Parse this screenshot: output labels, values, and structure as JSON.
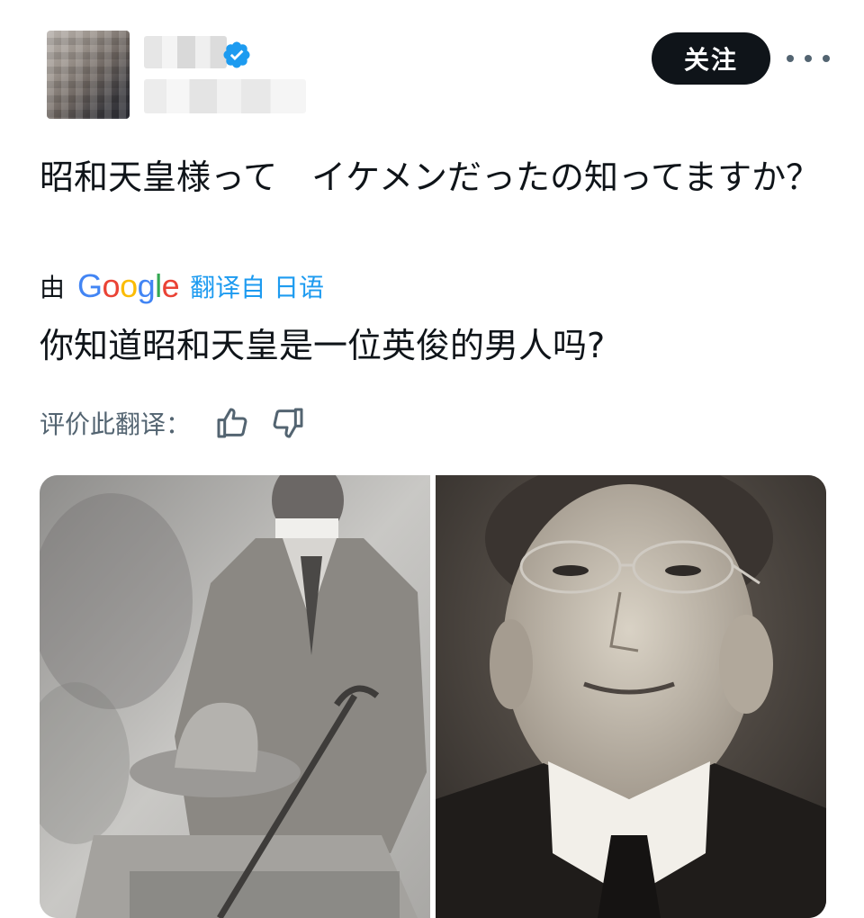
{
  "header": {
    "follow_label": "关注",
    "icons": [
      "verified-badge-icon",
      "more-options-icon"
    ]
  },
  "post": {
    "text": "昭和天皇様って　イケメンだったの知ってますか？",
    "translation_prefix": "由",
    "translation_provider": "Google",
    "translation_suffix": "翻译自 日语",
    "translated_text": "你知道昭和天皇是一位英俊的男人吗?",
    "rate_label": "评价此翻译："
  },
  "media": {
    "count": 2
  },
  "colors": {
    "accent": "#1d9bf0",
    "button_bg": "#0f1419",
    "muted": "#536471"
  }
}
